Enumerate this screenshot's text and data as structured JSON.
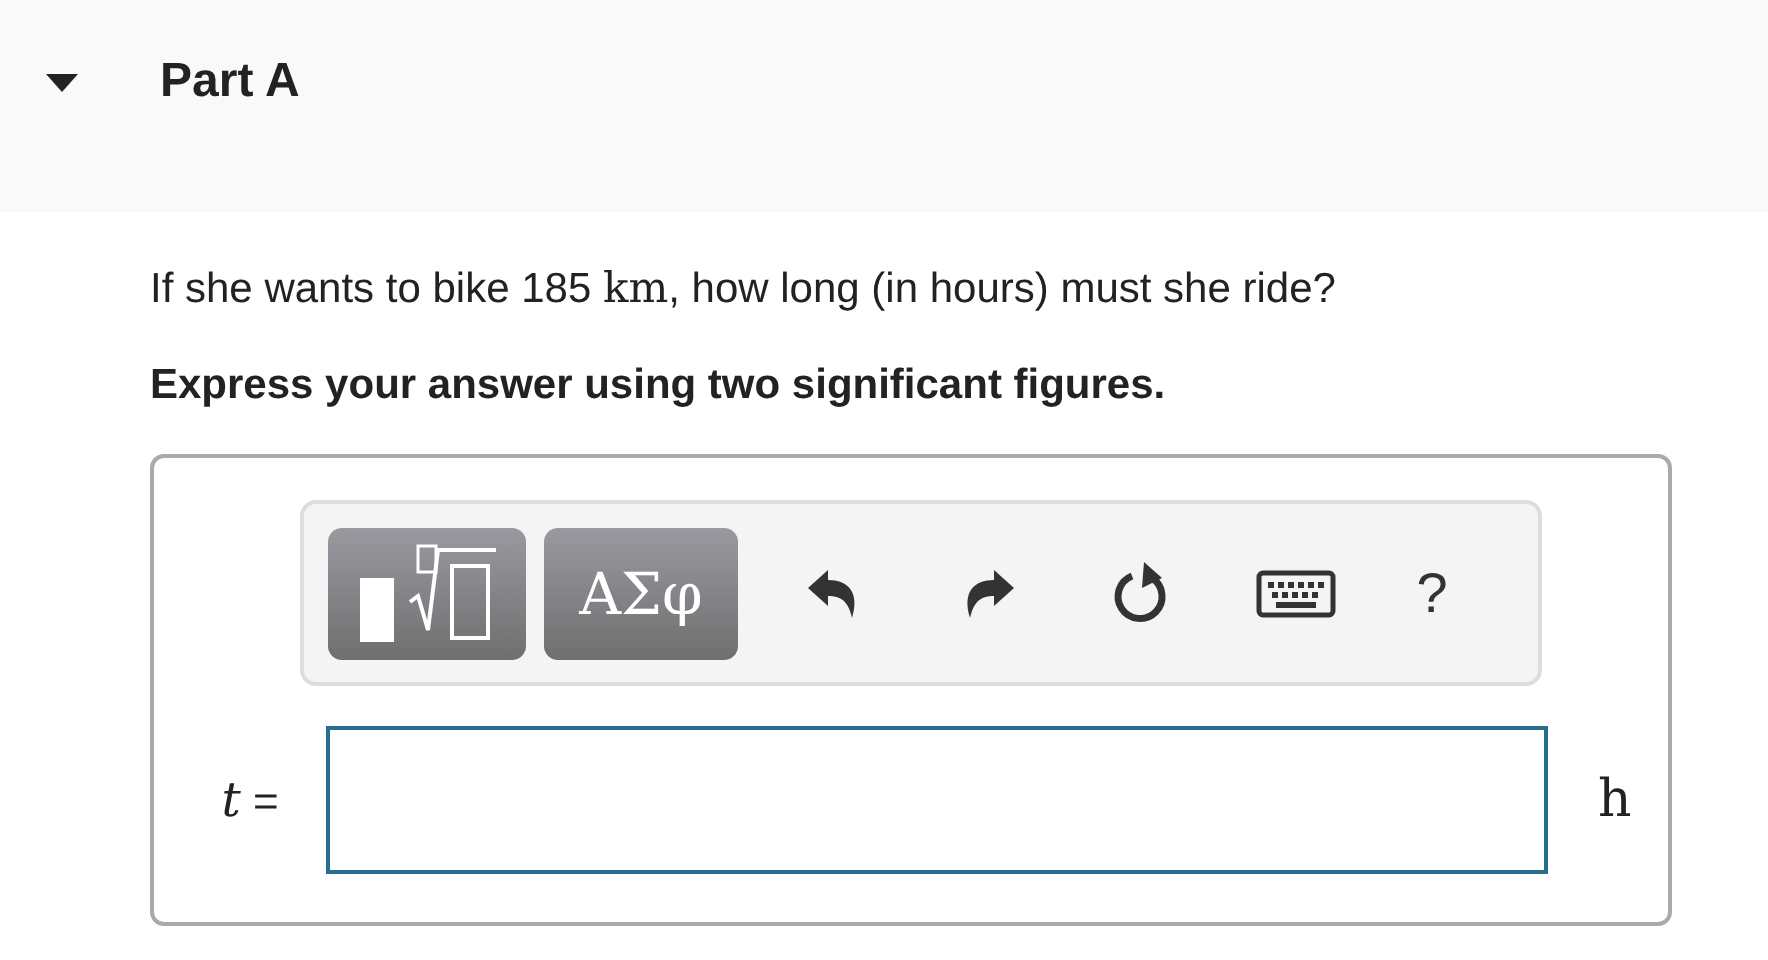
{
  "part": {
    "title": "Part A",
    "expanded": true
  },
  "question": {
    "before": "If she wants to bike 185 ",
    "unit": "km",
    "after": ", how long (in hours) must she ride?"
  },
  "instruction": "Express your answer using two significant figures.",
  "toolbar": [
    {
      "kind": "templates"
    },
    {
      "kind": "symbols",
      "label": "ΑΣφ"
    },
    {
      "kind": "undo"
    },
    {
      "kind": "redo"
    },
    {
      "kind": "reset"
    },
    {
      "kind": "keyboard"
    },
    {
      "kind": "help",
      "label": "?"
    }
  ],
  "answer": {
    "variable": "t",
    "equals": "=",
    "unit": "h"
  }
}
